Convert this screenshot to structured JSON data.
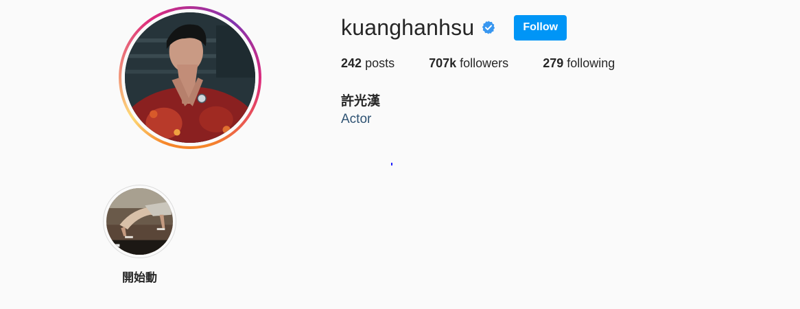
{
  "profile": {
    "username": "kuanghanhsu",
    "full_name": "許光漢",
    "category": "Actor",
    "follow_label": "Follow",
    "verified_icon": "verified-badge-icon"
  },
  "stats": {
    "posts_count": "242",
    "posts_label": "posts",
    "followers_count": "707k",
    "followers_label": "followers",
    "following_count": "279",
    "following_label": "following"
  },
  "highlights": [
    {
      "label": "開始動"
    }
  ],
  "colors": {
    "background": "#fafafa",
    "follow_button": "#0095f6",
    "verified_badge": "#3897f0",
    "category_link": "#2f5373",
    "text": "#262626"
  }
}
